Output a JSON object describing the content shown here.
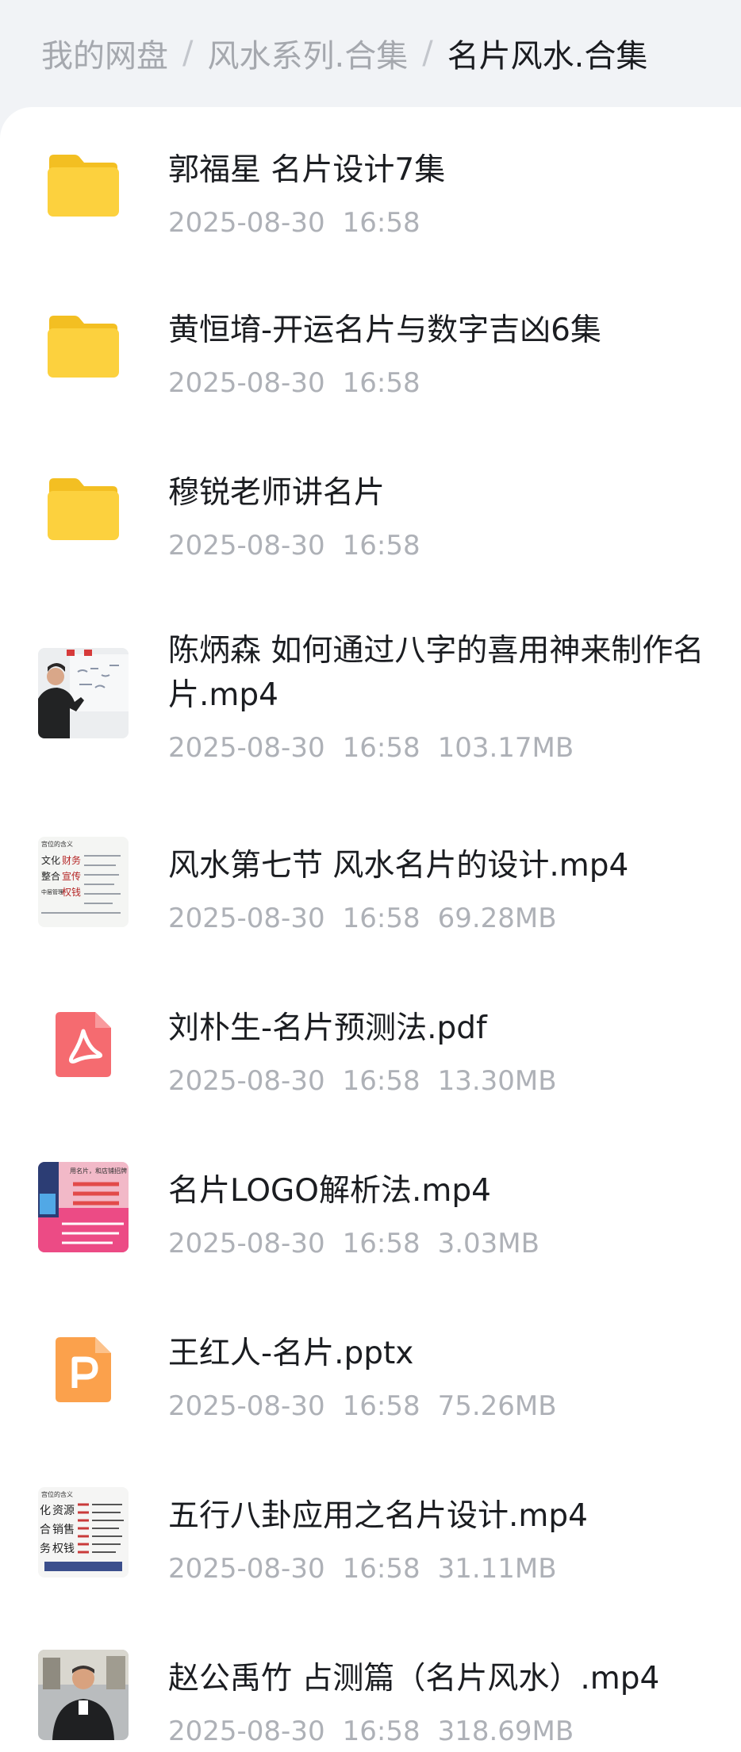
{
  "breadcrumb": {
    "items": [
      "我的网盘",
      "风水系列.合集",
      "名片风水.合集"
    ],
    "separator": "/"
  },
  "files": [
    {
      "name": "郭福星 名片设计7集",
      "date": "2025-08-30",
      "time": "16:58",
      "size": "",
      "type": "folder-icon"
    },
    {
      "name": "黄恒堉-开运名片与数字吉凶6集",
      "date": "2025-08-30",
      "time": "16:58",
      "size": "",
      "type": "folder-icon"
    },
    {
      "name": "穆锐老师讲名片",
      "date": "2025-08-30",
      "time": "16:58",
      "size": "",
      "type": "folder-icon"
    },
    {
      "name": "陈炳森 如何通过八字的喜用神来制作名片.mp4",
      "date": "2025-08-30",
      "time": "16:58",
      "size": "103.17MB",
      "type": "video-thumbnail"
    },
    {
      "name": "风水第七节 风水名片的设计.mp4",
      "date": "2025-08-30",
      "time": "16:58",
      "size": "69.28MB",
      "type": "video-thumbnail"
    },
    {
      "name": "刘朴生-名片预测法.pdf",
      "date": "2025-08-30",
      "time": "16:58",
      "size": "13.30MB",
      "type": "pdf-icon"
    },
    {
      "name": "名片LOGO解析法.mp4",
      "date": "2025-08-30",
      "time": "16:58",
      "size": "3.03MB",
      "type": "video-thumbnail"
    },
    {
      "name": "王红人-名片.pptx",
      "date": "2025-08-30",
      "time": "16:58",
      "size": "75.26MB",
      "type": "ppt-icon"
    },
    {
      "name": "五行八卦应用之名片设计.mp4",
      "date": "2025-08-30",
      "time": "16:58",
      "size": "31.11MB",
      "type": "video-thumbnail"
    },
    {
      "name": "赵公禹竹 占测篇（名片风水）.mp4",
      "date": "2025-08-30",
      "time": "16:58",
      "size": "318.69MB",
      "type": "video-thumbnail"
    }
  ],
  "thumb_text": {
    "t5_title": "宫位的含义",
    "t5_words": [
      "文化",
      "财务",
      "整合",
      "宣传",
      "中层管理",
      "权钱"
    ],
    "t7_title": "用名片，和店铺招牌",
    "t9_title": "宫位的含义",
    "t9_words": [
      "化",
      "资源",
      "合",
      "销售",
      "务",
      "权钱"
    ]
  },
  "colors": {
    "folder": "#fcd13e",
    "pdf": "#f56b70",
    "ppt": "#fba14c",
    "text_primary": "#1b1d21",
    "text_secondary": "#aeb1b7"
  }
}
